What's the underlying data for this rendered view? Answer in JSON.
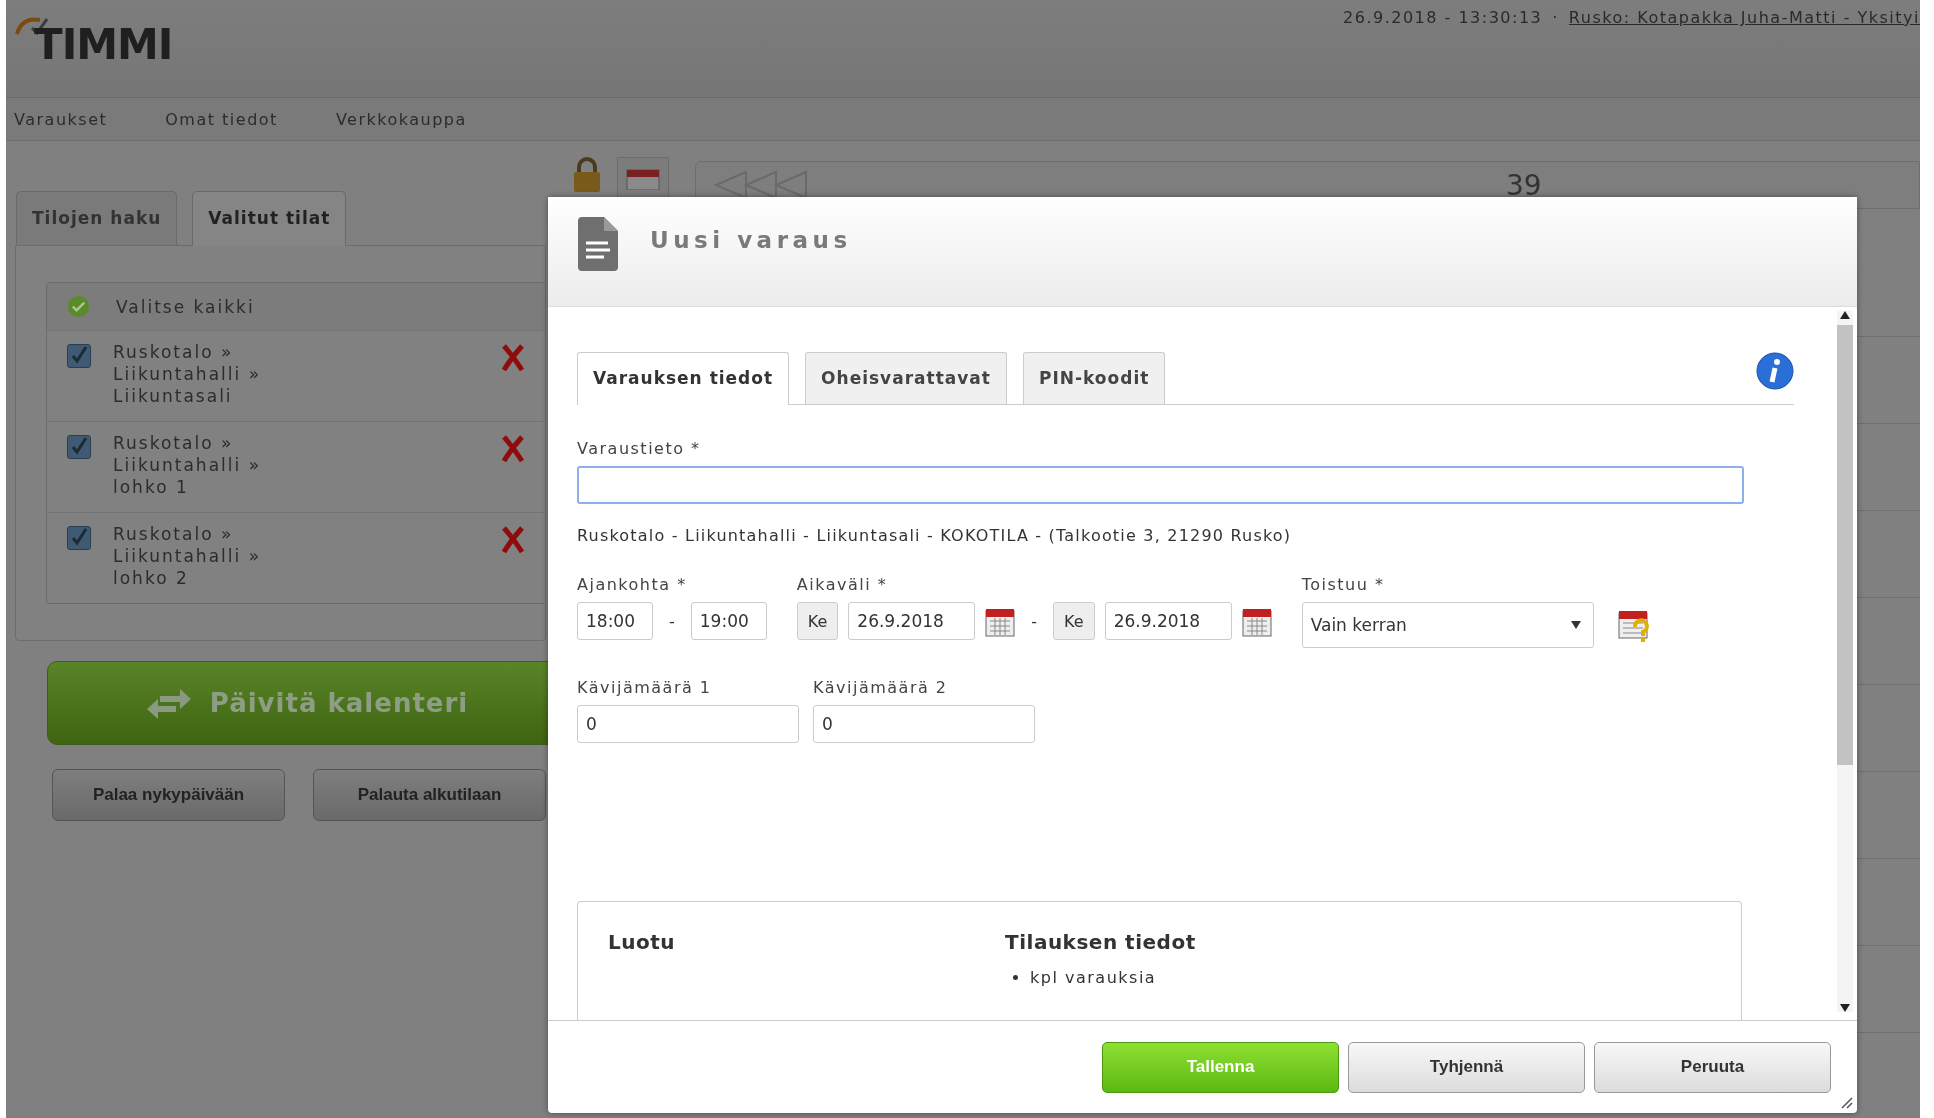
{
  "header": {
    "logo": "TIMMI",
    "timestamp": "26.9.2018 - 13:30:13",
    "separator": "·",
    "user_link": "Rusko: Kotapakka Juha-Matti - Yksityi"
  },
  "nav": [
    {
      "label": "Varaukset"
    },
    {
      "label": "Omat tiedot"
    },
    {
      "label": "Verkkokauppa"
    }
  ],
  "left_panel": {
    "tabs": [
      {
        "label": "Tilojen haku",
        "selected": false
      },
      {
        "label": "Valitut tilat",
        "selected": true
      }
    ],
    "select_all": "Valitse kaikki",
    "spaces": [
      {
        "lines": [
          "Ruskotalo »",
          "Liikuntahalli »",
          "Liikuntasali"
        ],
        "checked": true
      },
      {
        "lines": [
          "Ruskotalo »",
          "Liikuntahalli »",
          "lohko 1"
        ],
        "checked": true
      },
      {
        "lines": [
          "Ruskotalo »",
          "Liikuntahalli »",
          "lohko 2"
        ],
        "checked": true
      }
    ],
    "update_button": "Päivitä kalenteri",
    "buttons": [
      "Palaa nykypäivään",
      "Palauta alkutilaan"
    ]
  },
  "calendar": {
    "week": "39"
  },
  "dialog": {
    "title": "Uusi varaus",
    "tabs": [
      {
        "label": "Varauksen tiedot",
        "selected": true
      },
      {
        "label": "Oheisvarattavat",
        "selected": false
      },
      {
        "label": "PIN-koodit",
        "selected": false
      }
    ],
    "varaustieto_label": "Varaustieto *",
    "address": "Ruskotalo - Liikuntahalli - Liikuntasali - KOKOTILA - (Talkootie 3, 21290 Rusko)",
    "ajankohta": {
      "label": "Ajankohta *",
      "start": "18:00",
      "dash": "-",
      "end": "19:00"
    },
    "aikavali": {
      "label": "Aikaväli *",
      "start_day": "Ke",
      "start_date": "26.9.2018",
      "dash": "-",
      "end_day": "Ke",
      "end_date": "26.9.2018"
    },
    "toistuu": {
      "label": "Toistuu *",
      "value": "Vain kerran"
    },
    "visitors": [
      {
        "label": "Kävijämäärä 1",
        "value": "0"
      },
      {
        "label": "Kävijämäärä 2",
        "value": "0"
      }
    ],
    "summary": {
      "created": "Luotu",
      "order_title": "Tilauksen tiedot",
      "order_items": [
        "kpl varauksia"
      ]
    },
    "buttons": [
      {
        "label": "Tallenna",
        "kind": "primary"
      },
      {
        "label": "Tyhjennä",
        "kind": "default"
      },
      {
        "label": "Peruuta",
        "kind": "default"
      }
    ]
  }
}
